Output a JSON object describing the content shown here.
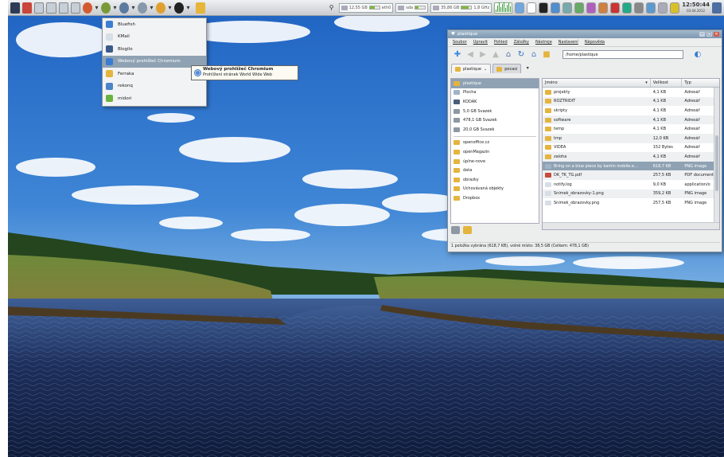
{
  "panel": {
    "launchers": [
      "pin-icon",
      "tool-icon",
      "pager-1",
      "pager-2",
      "pager-3",
      "pager-4"
    ],
    "menus": [
      {
        "name": "chromium-menu-icon",
        "arrow": "▾"
      },
      {
        "name": "bug-menu-icon",
        "arrow": "▾"
      },
      {
        "name": "office-menu-icon",
        "arrow": "▾"
      },
      {
        "name": "network-menu-icon",
        "arrow": "▾"
      },
      {
        "name": "media-menu-icon",
        "arrow": "▾"
      },
      {
        "name": "system-menu-icon",
        "arrow": "▾"
      }
    ],
    "disks": [
      {
        "label": "12,55 GB",
        "extra": "eth0",
        "fill": 0.55
      },
      {
        "label": "sda",
        "extra": "",
        "fill": 0.3
      },
      {
        "label": "35,86 GB",
        "extra": "1,8 GHz",
        "fill": 0.7
      }
    ],
    "clock_time": "12:50:44",
    "clock_date": "03.04.2012"
  },
  "menu": {
    "items": [
      {
        "label": "Bluefish",
        "icon": "bluefish-icon",
        "color": "#3d7fd0"
      },
      {
        "label": "KMail",
        "icon": "kmail-icon",
        "color": "#d8dee6"
      },
      {
        "label": "Blogilo",
        "icon": "blogilo-icon",
        "color": "#3a5a8a"
      },
      {
        "label": "Webový prohlížeč Chromium",
        "icon": "chromium-icon",
        "color": "#3a7cd0"
      },
      {
        "label": "Ferraka",
        "icon": "ferraka-icon",
        "color": "#e4b43e"
      },
      {
        "label": "rekonq",
        "icon": "rekonq-icon",
        "color": "#4b85c7"
      },
      {
        "label": "midori",
        "icon": "midori-icon",
        "color": "#6ab23f"
      }
    ],
    "selected": 3
  },
  "tooltip": {
    "title": "Webový prohlížeč Chromium",
    "desc": "Prohlížení stránek World Wide Web"
  },
  "window": {
    "title": "plastique",
    "menubar": [
      "Soubor",
      "Upravit",
      "Pohled",
      "Záložky",
      "Nástroje",
      "Nastavení",
      "Nápověda"
    ],
    "address": "/home/plastique",
    "tabs": [
      {
        "label": "plastique",
        "arrow": "⌄",
        "active": true
      },
      {
        "label": "pocasi",
        "arrow": "",
        "active": false
      }
    ],
    "places": [
      {
        "label": "plastique",
        "icon": "folder-icon",
        "color": "#e4b43e",
        "selected": true
      },
      {
        "label": "Plocha",
        "icon": "desktop-icon",
        "color": "#9fb3c8"
      },
      {
        "label": "KODAK",
        "icon": "camera-icon",
        "color": "#4a5d7a"
      },
      {
        "label": "5,0 GB Svazek",
        "icon": "drive-icon",
        "color": "#8d98a3"
      },
      {
        "label": "478,1 GB Svazek",
        "icon": "drive-icon",
        "color": "#8d98a3"
      },
      {
        "label": "20,0 GB Svazek",
        "icon": "drive-icon",
        "color": "#8d98a3"
      },
      {
        "label": "openoffice.cz",
        "icon": "folder-icon",
        "color": "#e4b43e",
        "sep": true
      },
      {
        "label": "openMagazin",
        "icon": "folder-icon",
        "color": "#e4b43e"
      },
      {
        "label": "úplne-nove",
        "icon": "folder-icon",
        "color": "#e4b43e"
      },
      {
        "label": "data",
        "icon": "folder-icon",
        "color": "#e4b43e"
      },
      {
        "label": "obrazky",
        "icon": "folder-icon",
        "color": "#e4b43e"
      },
      {
        "label": "Uchovávaná objekty",
        "icon": "folder-icon",
        "color": "#e4b43e"
      },
      {
        "label": "Dropbox",
        "icon": "folder-icon",
        "color": "#e4b43e"
      }
    ],
    "columns": [
      "Jméno",
      "Velikost",
      "Typ"
    ],
    "files": [
      {
        "name": "projekty",
        "size": "4,1 KB",
        "type": "Adresář",
        "color": "#e4b43e"
      },
      {
        "name": "ROZTRIDIT",
        "size": "4,1 KB",
        "type": "Adresář",
        "color": "#e4b43e"
      },
      {
        "name": "skripty",
        "size": "4,1 KB",
        "type": "Adresář",
        "color": "#e4b43e"
      },
      {
        "name": "software",
        "size": "4,1 KB",
        "type": "Adresář",
        "color": "#e4b43e"
      },
      {
        "name": "temp",
        "size": "4,1 KB",
        "type": "Adresář",
        "color": "#e4b43e"
      },
      {
        "name": "tmp",
        "size": "12,0 KB",
        "type": "Adresář",
        "color": "#e4b43e"
      },
      {
        "name": "VIDEA",
        "size": "152 Bytes",
        "type": "Adresář",
        "color": "#e4b43e"
      },
      {
        "name": "zaloha",
        "size": "4,1 KB",
        "type": "Adresář",
        "color": "#e4b43e"
      },
      {
        "name": "Bring on a blue piece by kamin mobile.e...",
        "size": "618,7 KB",
        "type": "PNG image",
        "color": "#9fb3c8",
        "selected": true
      },
      {
        "name": "DK_TK_TG.pdf",
        "size": "257,5 KB",
        "type": "PDF document",
        "color": "#c84a3a"
      },
      {
        "name": "notify.log",
        "size": "9,0 KB",
        "type": "application/o",
        "color": "#d8dee6"
      },
      {
        "name": "Snímek_obrazovky-1.png",
        "size": "359,2 KB",
        "type": "PNG image",
        "color": "#d8dee6"
      },
      {
        "name": "Snímek_obrazovky.png",
        "size": "257,5 KB",
        "type": "PNG image",
        "color": "#d8dee6"
      }
    ],
    "status": "1 položka vybrána (618,7 KB), volné místo: 38,5 GB (Celkem: 478,1 GB)"
  }
}
